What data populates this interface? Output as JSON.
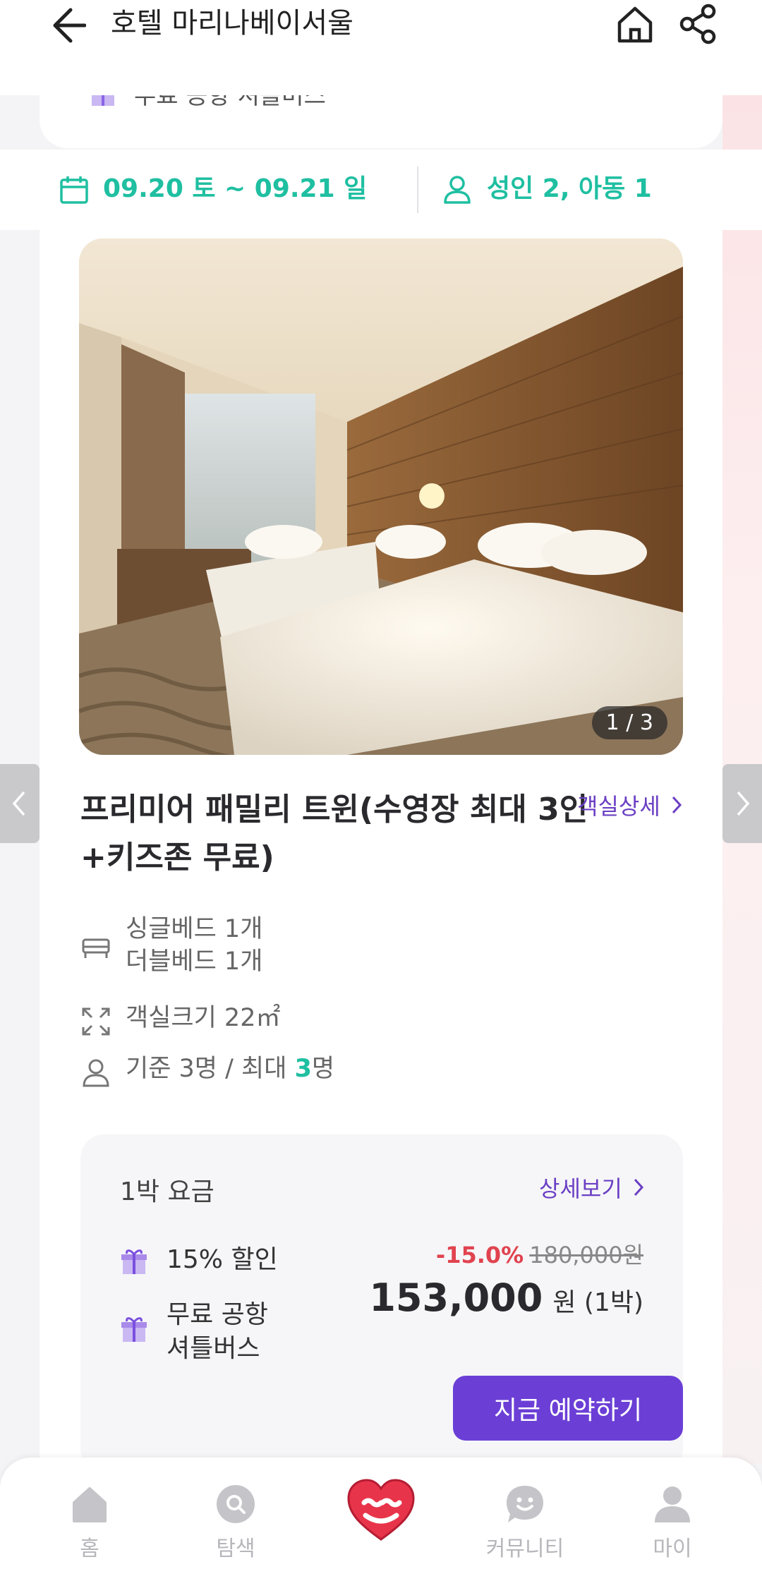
{
  "header": {
    "title": "호텔 마리나베이서울",
    "back_icon": "back-arrow-icon",
    "home_icon": "home-icon",
    "share_icon": "share-icon"
  },
  "peek_card": {
    "text": "무료 공항 셔틀버스"
  },
  "date_bar": {
    "dates": "09.20 토 ~ 09.21 일",
    "guests": "성인 2, 아동 1",
    "accent_color": "#1fbfa1"
  },
  "room": {
    "photo_counter": "1 / 3",
    "name": "프리미어 패밀리 트윈(수영장 최대 3인+키즈존 무료)",
    "detail_link": "객실상세",
    "beds": [
      "싱글베드 1개",
      "더블베드 1개"
    ],
    "size": "객실크기 22㎡",
    "capacity_prefix": "기준 3명 / 최대 ",
    "capacity_max": "3",
    "capacity_suffix": "명"
  },
  "price": {
    "title": "1박 요금",
    "detail_link": "상세보기",
    "perks": [
      "15% 할인",
      "무료 공항\n셔틀버스"
    ],
    "discount_pct": "-15.0%",
    "original_price": "180,000원",
    "amount": "153,000",
    "unit": "원 (1박)",
    "book_button": "지금 예약하기",
    "brand_color": "#6b3fd6"
  },
  "bottom_nav": {
    "items": [
      {
        "label": "홈",
        "icon": "home-icon"
      },
      {
        "label": "탐색",
        "icon": "search-icon"
      },
      {
        "label": "",
        "icon": "heart-logo-icon"
      },
      {
        "label": "커뮤니티",
        "icon": "smile-chat-icon"
      },
      {
        "label": "마이",
        "icon": "user-icon"
      }
    ]
  }
}
